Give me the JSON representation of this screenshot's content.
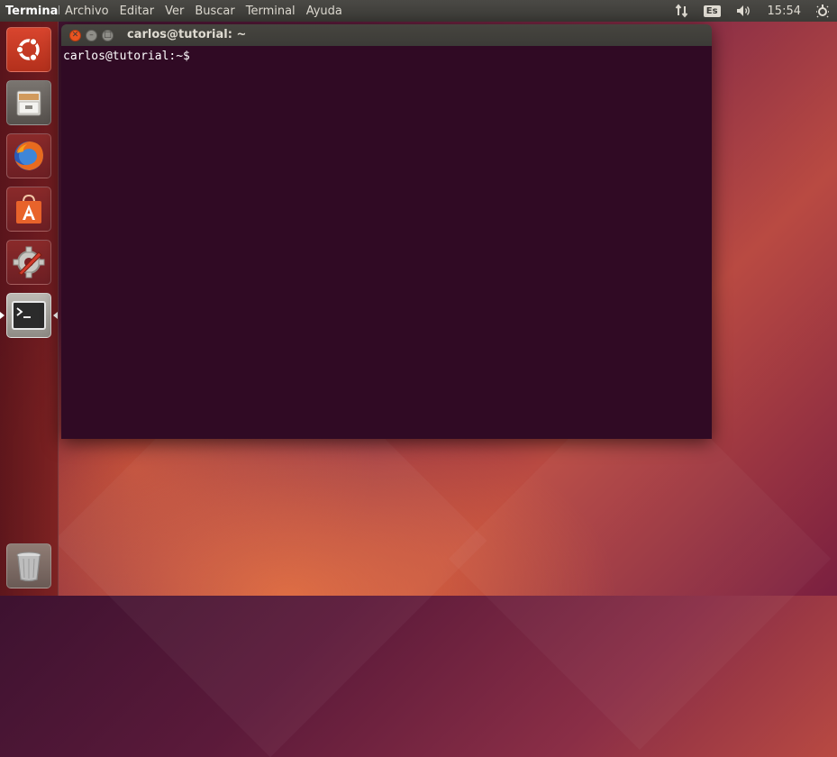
{
  "top_panel": {
    "app_name": "Terminal",
    "menu": [
      "Archivo",
      "Editar",
      "Ver",
      "Buscar",
      "Terminal",
      "Ayuda"
    ],
    "keyboard_layout": "Es",
    "clock": "15:54"
  },
  "launcher": {
    "items": [
      {
        "name": "dash-home",
        "icon": "ubuntu-logo-icon"
      },
      {
        "name": "files",
        "icon": "file-cabinet-icon"
      },
      {
        "name": "firefox",
        "icon": "firefox-icon"
      },
      {
        "name": "software-center",
        "icon": "shopping-bag-icon"
      },
      {
        "name": "system-settings",
        "icon": "wrench-gear-icon"
      },
      {
        "name": "terminal",
        "icon": "terminal-icon",
        "active": true
      },
      {
        "name": "trash",
        "icon": "trash-icon"
      }
    ]
  },
  "terminal_window": {
    "title": "carlos@tutorial: ~",
    "prompt": "carlos@tutorial:~$"
  },
  "colors": {
    "terminal_bg": "#300a24",
    "panel_bg": "#3c3b37",
    "close_button": "#e95420"
  }
}
